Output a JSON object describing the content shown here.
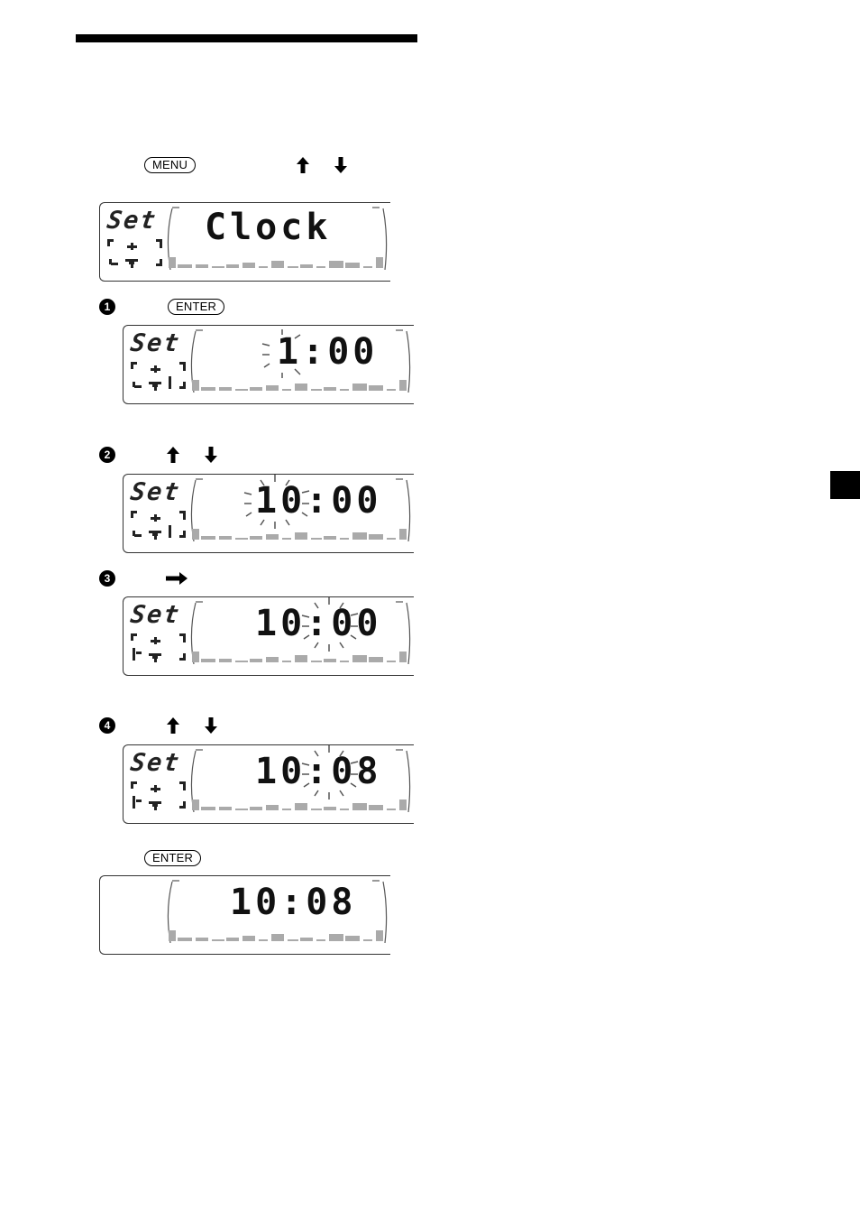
{
  "page": {
    "accent_color": "#000000",
    "side_tab_color": "#000000"
  },
  "intro": {
    "menu_key": "MENU",
    "up_icon": "arrow-up-icon",
    "down_icon": "arrow-down-icon"
  },
  "initial_display": {
    "indicator": "Set",
    "text": "Clock"
  },
  "steps": [
    {
      "number": "1",
      "key": "ENTER",
      "display": {
        "indicator": "Set",
        "hour": "1",
        "separator": ":",
        "minute": "00",
        "blinking": "hour"
      }
    },
    {
      "number": "2",
      "keys": [
        "arrow-up-icon",
        "arrow-down-icon"
      ],
      "display": {
        "indicator": "Set",
        "hour": "10",
        "separator": ":",
        "minute": "00",
        "blinking": "hour"
      }
    },
    {
      "number": "3",
      "keys": [
        "arrow-right-icon"
      ],
      "display": {
        "indicator": "Set",
        "hour": "10",
        "separator": ":",
        "minute": "00",
        "blinking": "minute"
      }
    },
    {
      "number": "4",
      "keys": [
        "arrow-up-icon",
        "arrow-down-icon"
      ],
      "display": {
        "indicator": "Set",
        "hour": "10",
        "separator": ":",
        "minute": "08",
        "blinking": "minute"
      }
    }
  ],
  "final": {
    "key": "ENTER",
    "display": {
      "hour": "10",
      "separator": ":",
      "minute": "08"
    }
  }
}
